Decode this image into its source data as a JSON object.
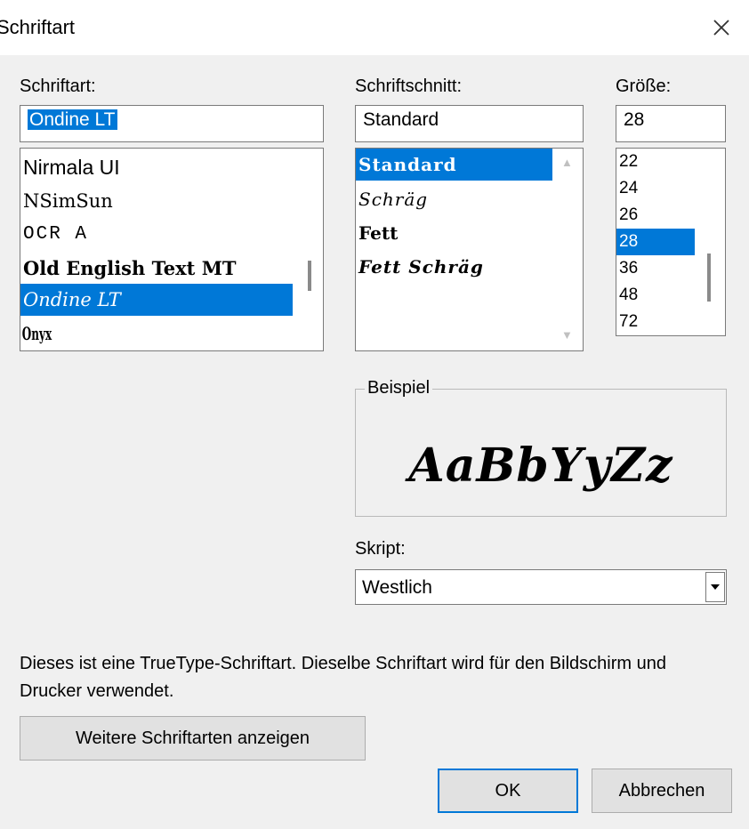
{
  "window": {
    "title": "Schriftart",
    "close_glyph": "×"
  },
  "font": {
    "label": "Schriftart:",
    "value": "Ondine LT",
    "items": [
      "Nirmala UI",
      "NSimSun",
      "OCR A",
      "Old English Text MT",
      "Ondine LT",
      "Onyx"
    ],
    "selected_index": 4
  },
  "style": {
    "label": "Schriftschnitt:",
    "value": "Standard",
    "items": [
      "Standard",
      "Schräg",
      "Fett",
      "Fett Schräg"
    ],
    "selected_index": 0
  },
  "size": {
    "label": "Größe:",
    "value": "28",
    "items": [
      "22",
      "24",
      "26",
      "28",
      "36",
      "48",
      "72"
    ],
    "selected_index": 3
  },
  "sample": {
    "title": "Beispiel",
    "text": "AaBbYyZz"
  },
  "script": {
    "label": "Skript:",
    "value": "Westlich"
  },
  "info_text": "Dieses ist eine TrueType-Schriftart. Dieselbe Schriftart wird für den Bildschirm und Drucker verwendet.",
  "buttons": {
    "more_fonts": "Weitere Schriftarten anzeigen",
    "ok": "OK",
    "cancel": "Abbrechen"
  },
  "colors": {
    "selection": "#0078d7",
    "dialog_bg": "#f0f0f0"
  }
}
